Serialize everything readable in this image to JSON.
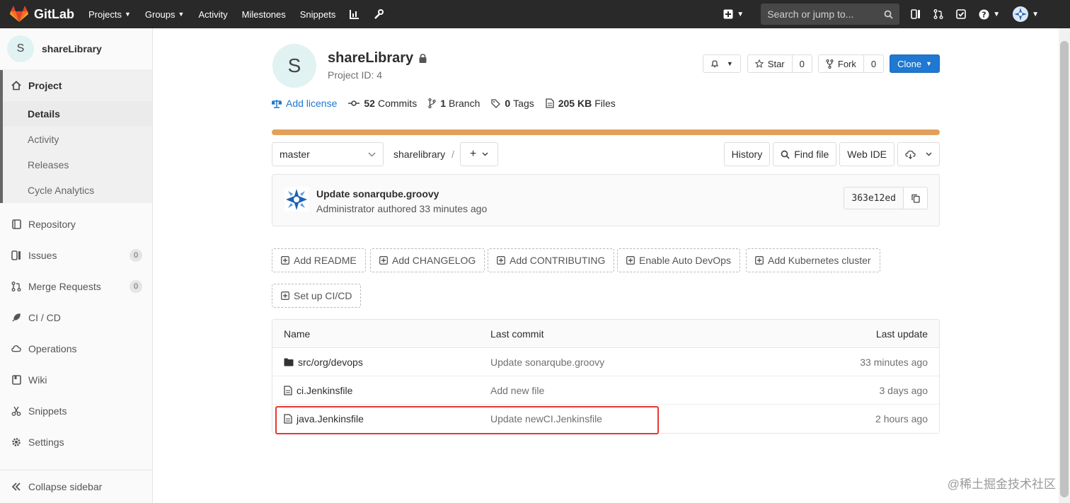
{
  "navbar": {
    "brand": "GitLab",
    "items": [
      "Projects",
      "Groups",
      "Activity",
      "Milestones",
      "Snippets"
    ],
    "search_placeholder": "Search or jump to..."
  },
  "sidebar": {
    "avatar_letter": "S",
    "project_name": "shareLibrary",
    "project_label": "Project",
    "sub_items": [
      "Details",
      "Activity",
      "Releases",
      "Cycle Analytics"
    ],
    "items": [
      {
        "label": "Repository",
        "icon": "book-icon"
      },
      {
        "label": "Issues",
        "icon": "issues-icon",
        "badge": "0"
      },
      {
        "label": "Merge Requests",
        "icon": "merge-request-icon",
        "badge": "0"
      },
      {
        "label": "CI / CD",
        "icon": "rocket-icon"
      },
      {
        "label": "Operations",
        "icon": "cloud-gear-icon"
      },
      {
        "label": "Wiki",
        "icon": "wiki-book-icon"
      },
      {
        "label": "Snippets",
        "icon": "scissors-icon"
      },
      {
        "label": "Settings",
        "icon": "gear-icon"
      }
    ],
    "collapse_label": "Collapse sidebar"
  },
  "project": {
    "avatar_letter": "S",
    "name": "shareLibrary",
    "id_label": "Project ID: 4",
    "star_label": "Star",
    "star_count": "0",
    "fork_label": "Fork",
    "fork_count": "0",
    "clone_label": "Clone"
  },
  "stats": {
    "license": "Add license",
    "commits_num": "52",
    "commits_label": "Commits",
    "branch_num": "1",
    "branch_label": "Branch",
    "tags_num": "0",
    "tags_label": "Tags",
    "files_num": "205 KB",
    "files_label": "Files"
  },
  "languages_bar": {
    "color": "#e2a15a",
    "percent": 100
  },
  "toolbar": {
    "branch": "master",
    "path": "sharelibrary",
    "separator": "/",
    "history": "History",
    "find_file": "Find file",
    "web_ide": "Web IDE"
  },
  "last_commit": {
    "title": "Update sonarqube.groovy",
    "meta": "Administrator authored 33 minutes ago",
    "sha": "363e12ed"
  },
  "quick_actions": [
    "Add README",
    "Add CHANGELOG",
    "Add CONTRIBUTING",
    "Enable Auto DevOps",
    "Add Kubernetes cluster",
    "Set up CI/CD"
  ],
  "file_tree": {
    "headers": {
      "name": "Name",
      "last_commit": "Last commit",
      "last_update": "Last update"
    },
    "rows": [
      {
        "type": "folder",
        "name": "src/org/devops",
        "commit": "Update sonarqube.groovy",
        "update": "33 minutes ago"
      },
      {
        "type": "file",
        "name": "ci.Jenkinsfile",
        "commit": "Add new file",
        "update": "3 days ago"
      },
      {
        "type": "file",
        "name": "java.Jenkinsfile",
        "commit": "Update newCI.Jenkinsfile",
        "update": "2 hours ago"
      }
    ]
  },
  "watermark": "@稀土掘金技术社区"
}
